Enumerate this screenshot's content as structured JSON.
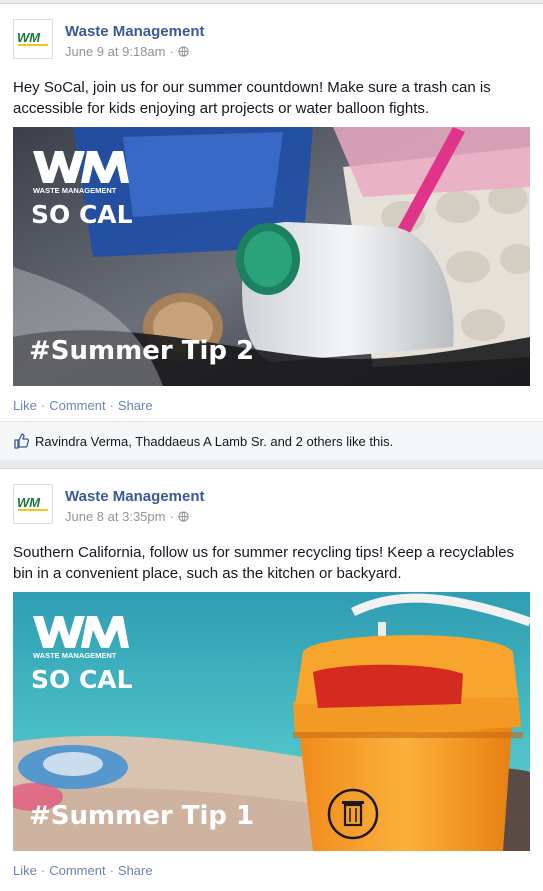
{
  "posts": [
    {
      "page_name": "Waste Management",
      "timestamp": "June 9 at 9:18am",
      "separator": "·",
      "text": "Hey SoCal, join us for our summer countdown! Make sure a trash can is accessible for kids enjoying art projects or water balloon fights.",
      "image": {
        "brand_wordmark": "WASTE MANAGEMENT",
        "region": "SO CAL",
        "tip": "#Summer Tip 2"
      },
      "actions": {
        "like": "Like",
        "comment": "Comment",
        "share": "Share",
        "sep": "·"
      },
      "likes_text": "Ravindra Verma, Thaddaeus A Lamb Sr. and 2 others like this."
    },
    {
      "page_name": "Waste Management",
      "timestamp": "June 8 at 3:35pm",
      "separator": "·",
      "text": "Southern California, follow us for summer recycling tips! Keep a recyclables bin in a convenient place, such as the kitchen or backyard.",
      "image": {
        "brand_wordmark": "WASTE MANAGEMENT",
        "region": "SO CAL",
        "tip": "#Summer Tip 1"
      },
      "actions": {
        "like": "Like",
        "comment": "Comment",
        "share": "Share",
        "sep": "·"
      }
    }
  ],
  "logo_text": "WM",
  "colors": {
    "page_link": "#3b5998",
    "action_link": "#6d84b4",
    "meta": "#90949c",
    "wm_green": "#1a7a3a",
    "wm_yellow": "#f5c518"
  },
  "icons": [
    "globe-icon",
    "thumbs-up-icon",
    "recycle-bin-icon"
  ]
}
